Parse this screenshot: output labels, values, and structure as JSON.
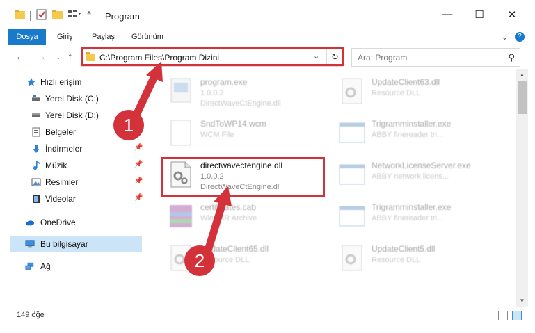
{
  "window": {
    "title": "Program",
    "minimize_glyph": "—",
    "maximize_glyph": "☐",
    "close_glyph": "✕"
  },
  "ribbon": {
    "tabs": [
      "Dosya",
      "Giriş",
      "Paylaş",
      "Görünüm"
    ],
    "expand_glyph": "⌄",
    "help_glyph": "?"
  },
  "address": {
    "path": "C:\\Program Files\\Program Dizini",
    "dropdown_glyph": "⌄",
    "refresh_glyph": "↻"
  },
  "search": {
    "placeholder": "Ara: Program",
    "icon": "search-icon"
  },
  "nav_pane": {
    "items": [
      {
        "label": "Hızlı erişim",
        "icon": "star-icon"
      },
      {
        "label": "Yerel Disk (C:)",
        "icon": "drive-icon"
      },
      {
        "label": "Yerel Disk (D:)",
        "icon": "drive-icon"
      },
      {
        "label": "Belgeler",
        "icon": "documents-icon"
      },
      {
        "label": "İndirmeler",
        "icon": "download-icon"
      },
      {
        "label": "Müzik",
        "icon": "music-icon"
      },
      {
        "label": "Resimler",
        "icon": "pictures-icon"
      },
      {
        "label": "Videolar",
        "icon": "video-icon"
      },
      {
        "label": "OneDrive",
        "icon": "cloud-icon"
      },
      {
        "label": "Bu bilgisayar",
        "icon": "computer-icon"
      },
      {
        "label": "Ağ",
        "icon": "network-icon"
      }
    ]
  },
  "files": [
    {
      "name": "program.exe",
      "line2": "1.0.0.2",
      "line3": "DirectWaveCtEngine.dll",
      "icon": "exe-icon"
    },
    {
      "name": "UpdateClient63.dll",
      "line2": "Resource DLL",
      "line3": "",
      "icon": "dll-icon"
    },
    {
      "name": "SndToWP14.wcm",
      "line2": "WCM File",
      "line3": "",
      "icon": "file-icon"
    },
    {
      "name": "Trigramminstaller.exe",
      "line2": "ABBY finereader tri...",
      "line3": "",
      "icon": "window-icon"
    },
    {
      "name": "directwavectengine.dll",
      "line2": "1.0.0.2",
      "line3": "DirectWaveCtEngine.dll",
      "icon": "dll-gear-icon"
    },
    {
      "name": "NetworkLicenseServer.exe",
      "line2": "ABBY network licens...",
      "line3": "",
      "icon": "window-icon"
    },
    {
      "name": "certificates.cab",
      "line2": "WinRAR Archive",
      "line3": "",
      "icon": "archive-icon"
    },
    {
      "name": "Trigramminstaller.exe",
      "line2": "ABBY finereader tri...",
      "line3": "",
      "icon": "window-icon"
    },
    {
      "name": "UpdateClient65.dll",
      "line2": "Resource DLL",
      "line3": "",
      "icon": "dll-icon"
    },
    {
      "name": "UpdateClient5.dll",
      "line2": "Resource DLL",
      "line3": "",
      "icon": "dll-icon"
    }
  ],
  "status": {
    "count": "149 öğe"
  },
  "annotations": {
    "step1": "1",
    "step2": "2",
    "color": "#d3323a"
  },
  "colors": {
    "ribbon_file_tab": "#1979ca",
    "selection": "#cce4f7"
  }
}
